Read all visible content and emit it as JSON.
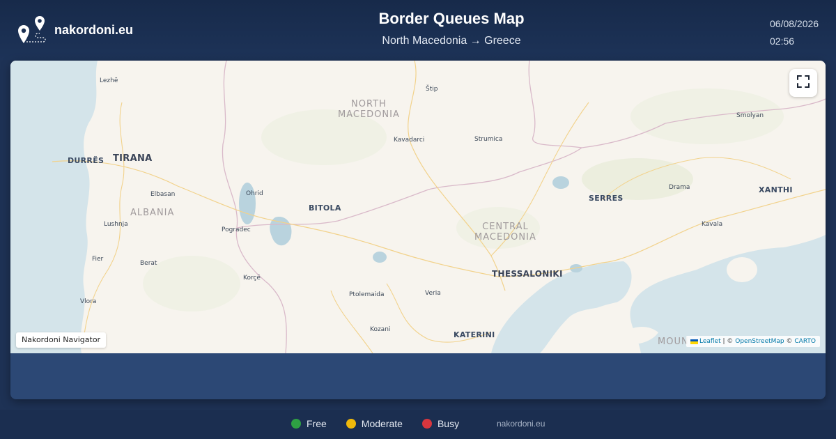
{
  "brand": {
    "name": "nakordoni.eu",
    "logo_icon": "map-pins-route-icon"
  },
  "header": {
    "title": "Border Queues Map",
    "route": "North Macedonia → Greece",
    "date": "06/08/2026",
    "time": "02:56"
  },
  "map": {
    "fullscreen_icon": "fullscreen-icon",
    "navigator_label": "Nakordoni Navigator",
    "attribution": {
      "leaflet": "Leaflet",
      "sep1": " | © ",
      "osm": "OpenStreetMap",
      "sep2": " © ",
      "carto": "CARTO"
    },
    "regions": {
      "north_macedonia_1": "NORTH",
      "north_macedonia_2": "MACEDONIA",
      "albania": "ALBANIA",
      "central_macedonia_1": "CENTRAL",
      "central_macedonia_2": "MACEDONIA",
      "mount": "MOUN"
    },
    "cities": {
      "lezhe": "Lezhë",
      "stip": "Štip",
      "smolyan": "Smolyan",
      "kavadarci": "Kavadarci",
      "strumica": "Strumica",
      "durres": "DURRËS",
      "tirana": "TIRANA",
      "elbasan": "Elbasan",
      "ohrid": "Ohrid",
      "drama": "Drama",
      "xanthi": "XANTHI",
      "serres": "SERRES",
      "bitola": "BITOLA",
      "lushnja": "Lushnja",
      "pogradec": "Pogradec",
      "kavala": "Kavala",
      "fier": "Fier",
      "berat": "Berat",
      "thessaloniki": "THESSALONIKI",
      "korce": "Korçë",
      "ptolemaida": "Ptolemaida",
      "veria": "Veria",
      "vlora": "Vlora",
      "kozani": "Kozani",
      "katerini": "KATERINI"
    }
  },
  "legend": [
    {
      "label": "Free",
      "color": "#2ea043"
    },
    {
      "label": "Moderate",
      "color": "#f0b90b"
    },
    {
      "label": "Busy",
      "color": "#d9363e"
    }
  ],
  "footer": {
    "site": "nakordoni.eu"
  }
}
